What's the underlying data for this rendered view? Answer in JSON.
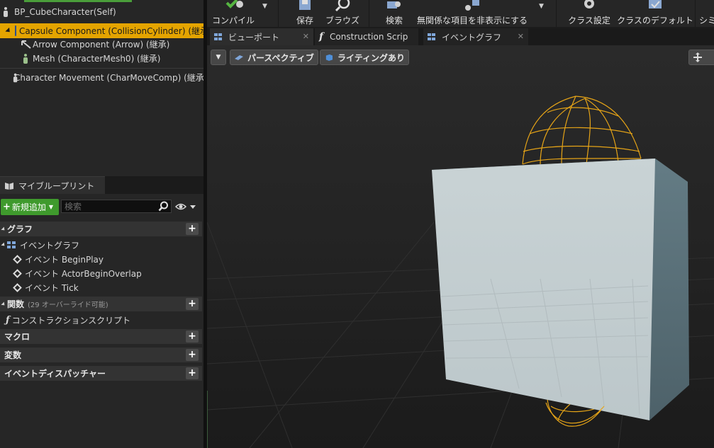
{
  "components": {
    "self_label": "BP_CubeCharacter(Self)",
    "items": [
      {
        "label": "Capsule Component (CollisionCylinder) (継承)"
      },
      {
        "label": "Arrow Component (Arrow) (継承)"
      },
      {
        "label": "Mesh (CharacterMesh0) (継承)"
      },
      {
        "label": "Character Movement (CharMoveComp) (継承)"
      }
    ]
  },
  "my_blueprint": {
    "tab_label": "マイブループリント",
    "add_new_label": "新規追加",
    "search_placeholder": "検索",
    "categories": {
      "graphs": "グラフ",
      "functions": "関数",
      "functions_sub": "(29 オーバーライド可能)",
      "macros": "マクロ",
      "variables": "変数",
      "dispatchers": "イベントディスパッチャー"
    },
    "event_graph_label": "イベントグラフ",
    "events": [
      "イベント BeginPlay",
      "イベント ActorBeginOverlap",
      "イベント Tick"
    ],
    "construction_script": "コンストラクションスクリプト"
  },
  "toolbar": {
    "compile": "コンパイル",
    "save": "保存",
    "browse": "ブラウズ",
    "find": "検索",
    "hide_unrelated": "無関係な項目を非表示にする",
    "class_settings": "クラス設定",
    "class_defaults": "クラスのデフォルト",
    "simulate": "シミ"
  },
  "tabs": {
    "viewport": "ビューポート",
    "construction": "Construction Scrip",
    "event_graph": "イベントグラフ"
  },
  "viewport": {
    "perspective": "パースペクティブ",
    "lighting": "ライティングあり"
  },
  "colors": {
    "selection": "#e4a400",
    "add_button": "#3f9a2d",
    "capsule_wire": "#e6a417",
    "cube_front": "#c6d0d2",
    "cube_side": "#5a6f76"
  }
}
